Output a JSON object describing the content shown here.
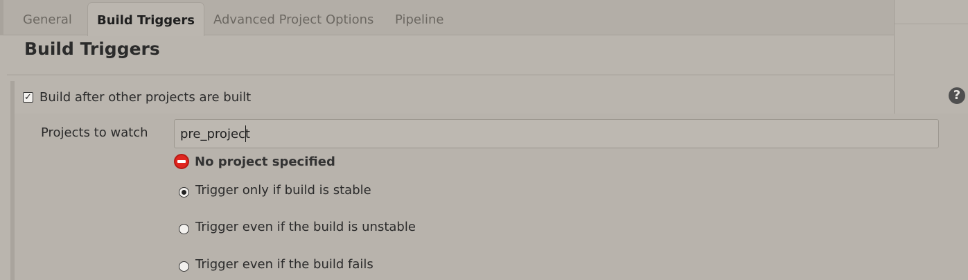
{
  "tabs": [
    {
      "label": "General",
      "active": false
    },
    {
      "label": "Build Triggers",
      "active": true
    },
    {
      "label": "Advanced Project Options",
      "active": false
    },
    {
      "label": "Pipeline",
      "active": false
    }
  ],
  "section": {
    "title": "Build Triggers"
  },
  "trigger": {
    "checkbox_label": "Build after other projects are built",
    "checked": true,
    "help_icon": "?"
  },
  "projects_field": {
    "label": "Projects to watch",
    "value": "pre_project"
  },
  "validation": {
    "icon": "error-stop-icon",
    "message": "No project specified",
    "color": "#e0261f"
  },
  "radio_options": [
    {
      "label": "Trigger only if build is stable",
      "selected": true
    },
    {
      "label": "Trigger even if the build is unstable",
      "selected": false
    },
    {
      "label": "Trigger even if the build fails",
      "selected": false
    }
  ]
}
